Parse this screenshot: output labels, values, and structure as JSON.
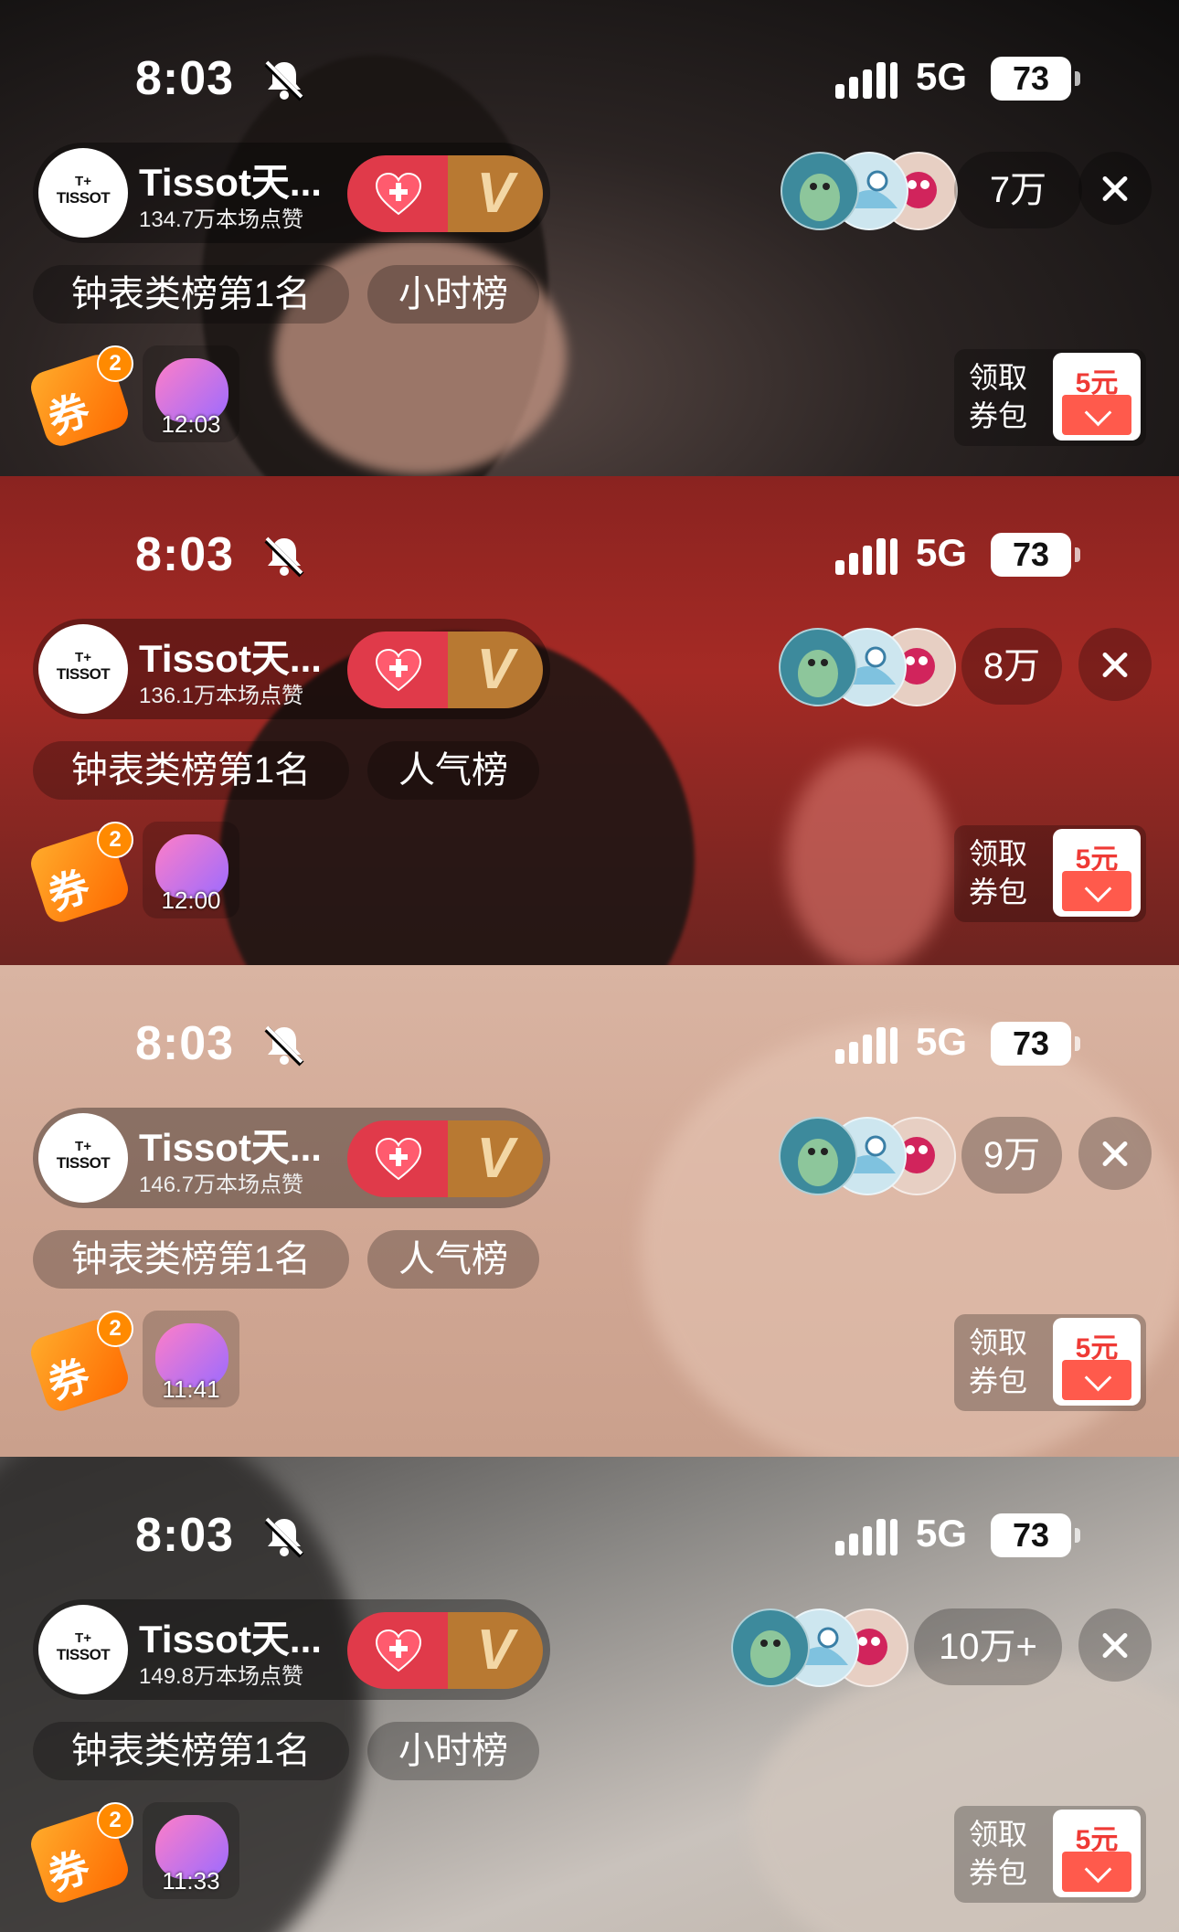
{
  "panels": [
    {
      "status": {
        "time": "8:03",
        "network": "5G",
        "battery": "73"
      },
      "host": {
        "name": "Tissot天...",
        "likes": "134.7万本场点赞",
        "logo_top": "T+",
        "logo_bottom": "TISSOT"
      },
      "vip_label": "V",
      "viewer_count": "7万",
      "tags": [
        "钟表类榜第1名",
        "小时榜"
      ],
      "coupon": {
        "label": "券",
        "badge": "2"
      },
      "gift_timer": "12:03",
      "pack": {
        "label": "领取券包",
        "value": "5元"
      }
    },
    {
      "status": {
        "time": "8:03",
        "network": "5G",
        "battery": "73"
      },
      "host": {
        "name": "Tissot天...",
        "likes": "136.1万本场点赞",
        "logo_top": "T+",
        "logo_bottom": "TISSOT"
      },
      "vip_label": "V",
      "viewer_count": "8万",
      "tags": [
        "钟表类榜第1名",
        "人气榜"
      ],
      "coupon": {
        "label": "券",
        "badge": "2"
      },
      "gift_timer": "12:00",
      "pack": {
        "label": "领取券包",
        "value": "5元"
      }
    },
    {
      "status": {
        "time": "8:03",
        "network": "5G",
        "battery": "73"
      },
      "host": {
        "name": "Tissot天...",
        "likes": "146.7万本场点赞",
        "logo_top": "T+",
        "logo_bottom": "TISSOT"
      },
      "vip_label": "V",
      "viewer_count": "9万",
      "tags": [
        "钟表类榜第1名",
        "人气榜"
      ],
      "coupon": {
        "label": "券",
        "badge": "2"
      },
      "gift_timer": "11:41",
      "pack": {
        "label": "领取券包",
        "value": "5元"
      }
    },
    {
      "status": {
        "time": "8:03",
        "network": "5G",
        "battery": "73"
      },
      "host": {
        "name": "Tissot天...",
        "likes": "149.8万本场点赞",
        "logo_top": "T+",
        "logo_bottom": "TISSOT"
      },
      "vip_label": "V",
      "viewer_count": "10万+",
      "tags": [
        "钟表类榜第1名",
        "小时榜"
      ],
      "coupon": {
        "label": "券",
        "badge": "2"
      },
      "gift_timer": "11:33",
      "pack": {
        "label": "领取券包",
        "value": "5元"
      }
    }
  ],
  "icons": {
    "bell": "bell-muted-icon",
    "signal": "signal-bars-icon",
    "heart": "heart-plus-icon",
    "close": "close-icon"
  },
  "colors": {
    "follow": "#e03a4a",
    "vip": "#b87932",
    "coupon": "#ff8a00",
    "pack_value": "#ef3a35"
  }
}
